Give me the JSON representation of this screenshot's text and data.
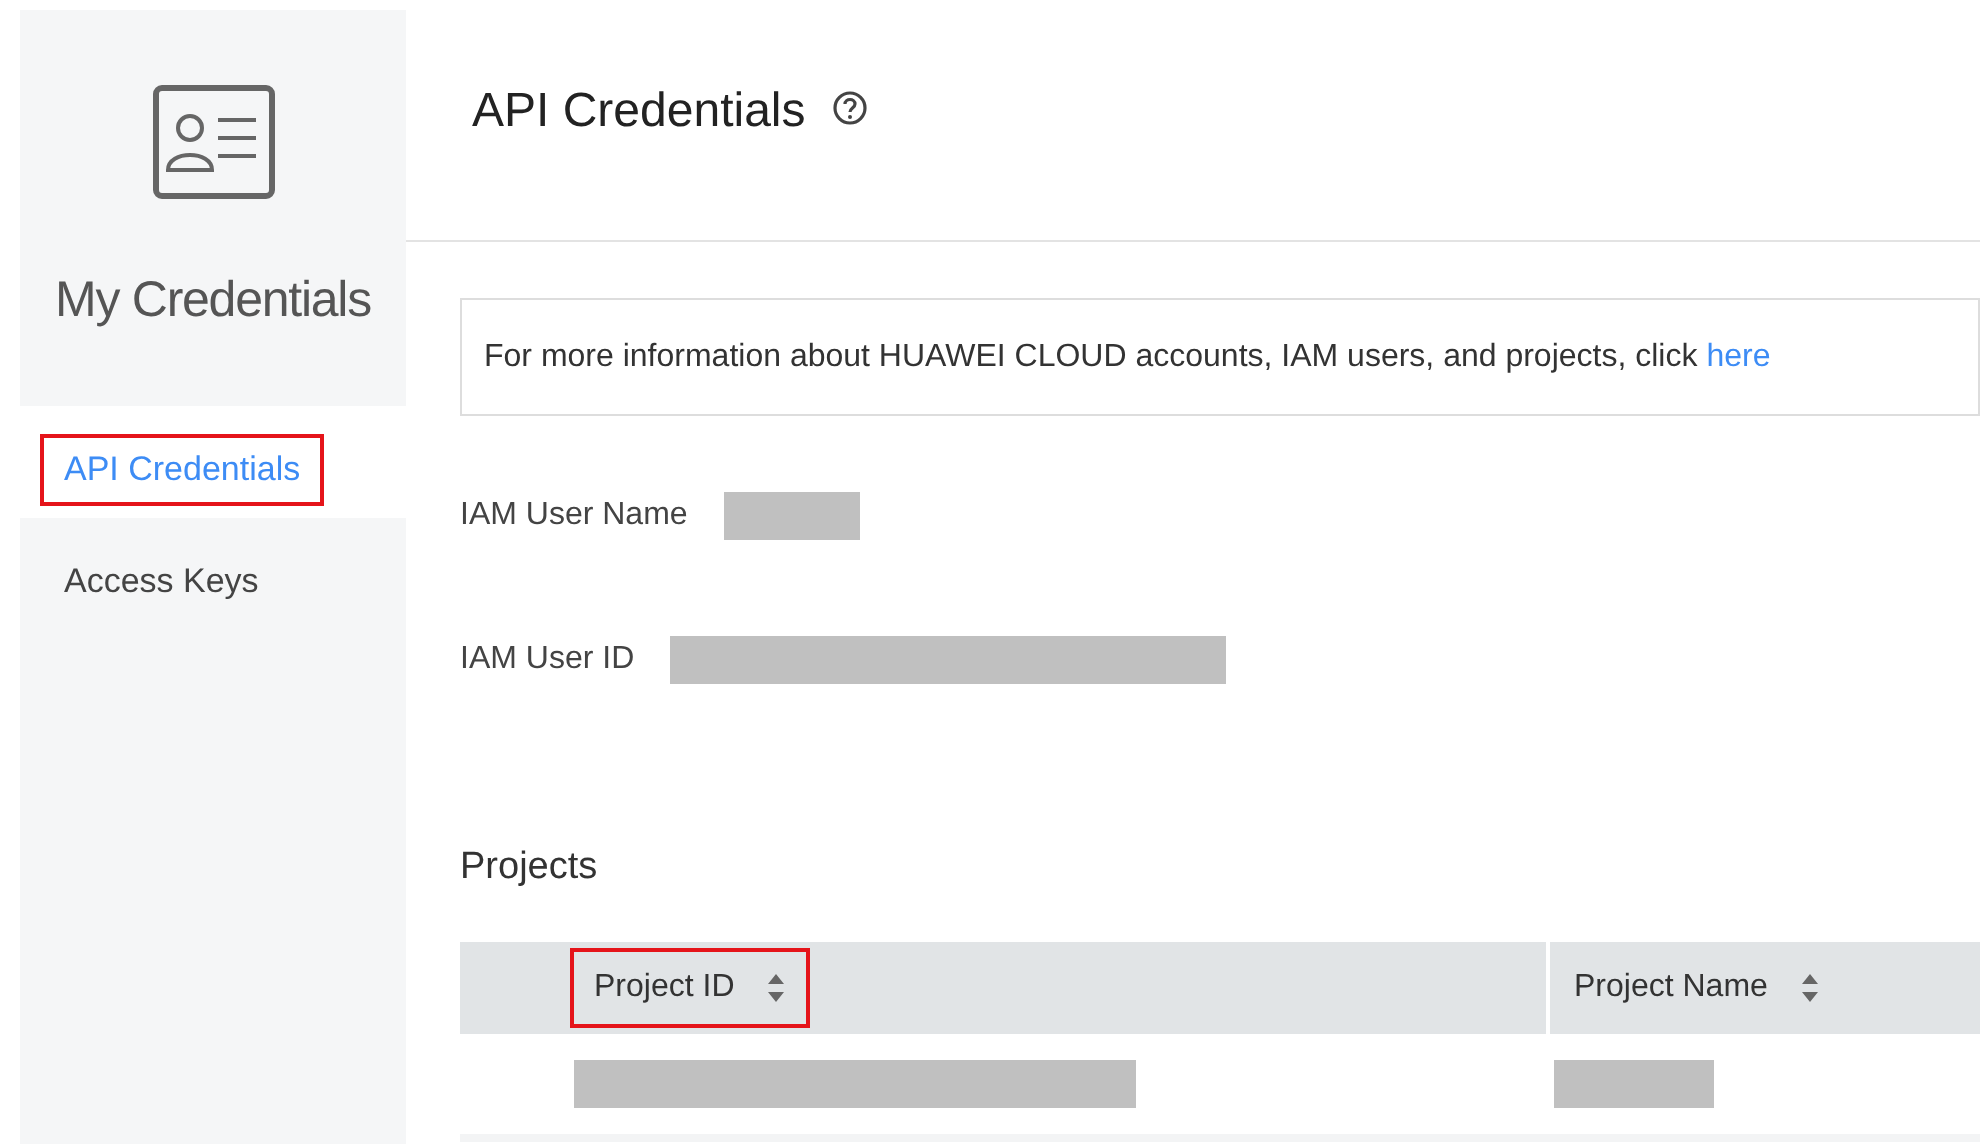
{
  "sidebar": {
    "title": "My Credentials",
    "items": [
      {
        "label": "API Credentials",
        "selected": true,
        "highlighted": true
      },
      {
        "label": "Access Keys",
        "selected": false,
        "highlighted": false
      }
    ]
  },
  "header": {
    "title": "API Credentials"
  },
  "info": {
    "text": "For more information about HUAWEI CLOUD accounts, IAM users, and projects, click",
    "link": "here"
  },
  "fields": [
    {
      "label": "IAM User Name",
      "kind": "redacted"
    },
    {
      "label": "IAM User ID",
      "kind": "redacted"
    }
  ],
  "projects": {
    "title": "Projects",
    "columns": [
      {
        "label": "Project ID",
        "highlighted": true
      },
      {
        "label": "Project Name",
        "highlighted": false
      }
    ],
    "rows": [
      {
        "kind": "redacted"
      }
    ]
  }
}
